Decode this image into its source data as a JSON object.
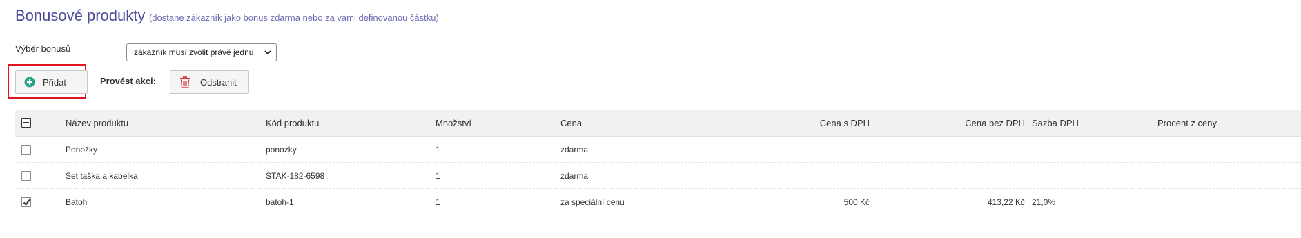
{
  "header": {
    "title": "Bonusové produkty",
    "subtitle": "(dostane zákazník jako bonus zdarma nebo za vámi definovanou částku)"
  },
  "bonus_selection": {
    "label": "Výběr bonusů",
    "selected": "zákazník musí zvolit právě jednu"
  },
  "toolbar": {
    "add_label": "Přidat",
    "action_label": "Provést akci:",
    "remove_label": "Odstranit"
  },
  "colors": {
    "title": "#4b4b96",
    "link": "#4b4b96",
    "highlight": "#e0141e",
    "add_icon": "#2aa58a",
    "remove_icon": "#d6373b"
  },
  "icons": {
    "add": "plus-circle-icon",
    "remove": "trash-icon",
    "select": "chevron-down-icon"
  },
  "table": {
    "columns": {
      "name": "Název produktu",
      "code": "Kód produktu",
      "qty": "Množství",
      "price": "Cena",
      "price_vat": "Cena s DPH",
      "price_novat": "Cena bez DPH",
      "vat_rate": "Sazba DPH",
      "percent": "Procent z ceny"
    },
    "rows": [
      {
        "checked": false,
        "name": "Ponožky",
        "code": "ponozky",
        "qty": "1",
        "price": "zdarma",
        "price_vat": "",
        "price_novat": "",
        "vat_rate": "",
        "percent": ""
      },
      {
        "checked": false,
        "name": "Set taška a kabelka",
        "code": "STAK-182-6598",
        "qty": "1",
        "price": "zdarma",
        "price_vat": "",
        "price_novat": "",
        "vat_rate": "",
        "percent": ""
      },
      {
        "checked": true,
        "name": "Batoh",
        "code": "batoh-1",
        "qty": "1",
        "price": "za speciální cenu",
        "price_vat": "500 Kč",
        "price_novat": "413,22 Kč",
        "vat_rate": "21,0%",
        "percent": ""
      }
    ]
  }
}
